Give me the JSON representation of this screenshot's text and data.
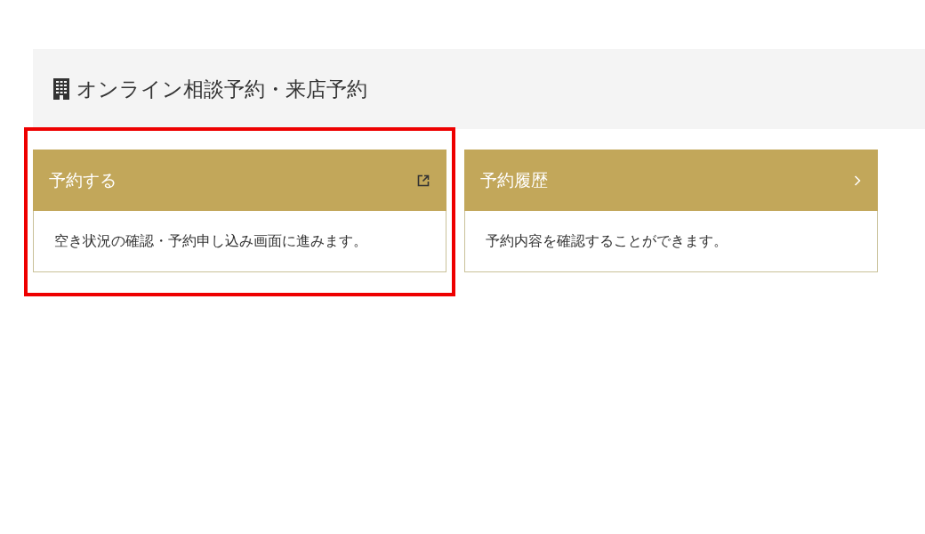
{
  "section": {
    "title": "オンライン相談予約・来店予約"
  },
  "cards": [
    {
      "title": "予約する",
      "kind": "external",
      "highlighted": true,
      "description": "空き状況の確認・予約申し込み画面に進みます。"
    },
    {
      "title": "予約履歴",
      "kind": "chevron",
      "highlighted": false,
      "description": "予約内容を確認することができます。"
    }
  ]
}
